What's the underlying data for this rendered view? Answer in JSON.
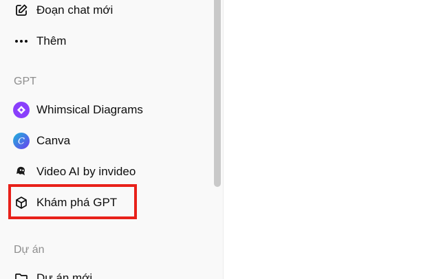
{
  "sidebar": {
    "new_chat": {
      "label": "Đoạn chat mới",
      "icon": "edit-icon"
    },
    "more": {
      "label": "Thêm",
      "icon": "more-dots-icon"
    },
    "gpt_section": "GPT",
    "gpts": [
      {
        "label": "Whimsical Diagrams",
        "icon": "whimsical-icon"
      },
      {
        "label": "Canva",
        "icon": "canva-icon"
      },
      {
        "label": "Video AI by invideo",
        "icon": "invideo-icon"
      },
      {
        "label": "Khám phá GPT",
        "icon": "cube-icon"
      }
    ],
    "projects_section": "Dự án",
    "new_project": {
      "label": "Dự án mới",
      "icon": "folder-icon"
    }
  },
  "colors": {
    "highlight": "#e8211a",
    "whimsical": "#8a3ffc",
    "canva": "#1fb5d9"
  }
}
